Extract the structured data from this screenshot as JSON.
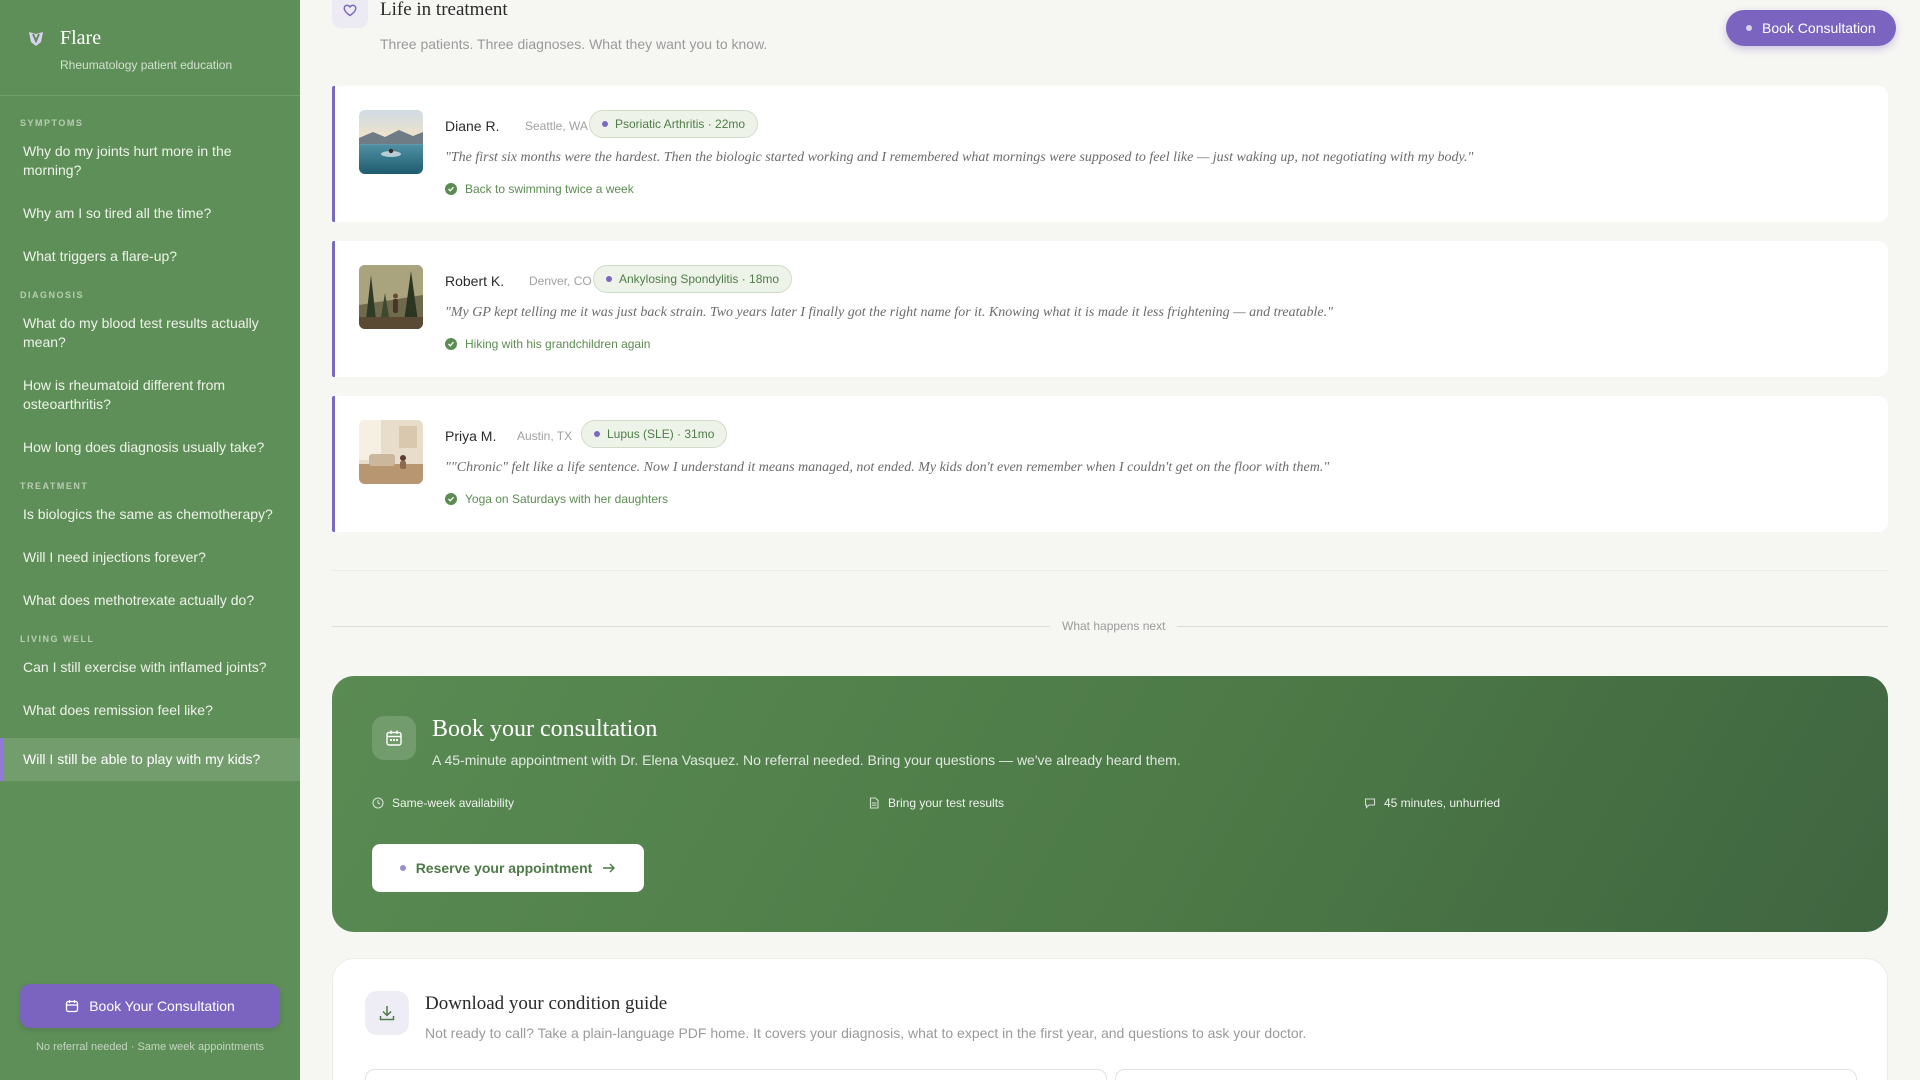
{
  "sidebar": {
    "brand_name": "Flare",
    "brand_sub": "Rheumatology patient education",
    "sections": [
      {
        "label": "SYMPTOMS",
        "items": [
          "Why do my joints hurt more in the morning?",
          "Why am I so tired all the time?",
          "What triggers a flare-up?"
        ]
      },
      {
        "label": "DIAGNOSIS",
        "items": [
          "What do my blood test results actually mean?",
          "How is rheumatoid different from osteoarthritis?",
          "How long does diagnosis usually take?"
        ]
      },
      {
        "label": "TREATMENT",
        "items": [
          "Is biologics the same as chemotherapy?",
          "Will I need injections forever?",
          "What does methotrexate actually do?"
        ]
      },
      {
        "label": "LIVING WELL",
        "items": [
          "Can I still exercise with inflamed joints?",
          "What does remission feel like?",
          "Will I still be able to play with my kids?"
        ]
      }
    ],
    "cta_label": "Book Your Consultation",
    "cta_note": "No referral needed · Same week appointments"
  },
  "header": {
    "title": "Life in treatment",
    "subtitle": "Three patients. Three diagnoses. What they want you to know.",
    "cta_label": "Book Consultation"
  },
  "stories": [
    {
      "name": "Diane R.",
      "location": "Seattle, WA",
      "tag": "Psoriatic Arthritis · 22mo",
      "quote": "\"The first six months were the hardest. Then the biologic started working and I remembered what mornings were supposed to feel like — just waking up, not negotiating with my body.\"",
      "outcome": "Back to swimming twice a week"
    },
    {
      "name": "Robert K.",
      "location": "Denver, CO",
      "tag": "Ankylosing Spondylitis · 18mo",
      "quote": "\"My GP kept telling me it was just back strain. Two years later I finally got the right name for it. Knowing what it is made it less frightening — and treatable.\"",
      "outcome": "Hiking with his grandchildren again"
    },
    {
      "name": "Priya M.",
      "location": "Austin, TX",
      "tag": "Lupus (SLE) · 31mo",
      "quote": "\"\"Chronic\" felt like a life sentence. Now I understand it means managed, not ended. My kids don't even remember when I couldn't get on the floor with them.\"",
      "outcome": "Yoga on Saturdays with her daughters"
    }
  ],
  "divider_label": "What happens next",
  "consult": {
    "title": "Book your consultation",
    "subtitle": "A 45-minute appointment with Dr. Elena Vasquez. No referral needed. Bring your questions — we've already heard them.",
    "features": [
      "Same-week availability",
      "Bring your test results",
      "45 minutes, unhurried"
    ],
    "button_label": "Reserve your appointment"
  },
  "download": {
    "title": "Download your condition guide",
    "subtitle": "Not ready to call? Take a plain-language PDF home. It covers your diagnosis, what to expect in the first year, and questions to ask your doctor."
  },
  "colors": {
    "sidebar_bg": "#5f8f58",
    "accent_purple": "#7a64c0",
    "green_text": "#5b8c51"
  }
}
